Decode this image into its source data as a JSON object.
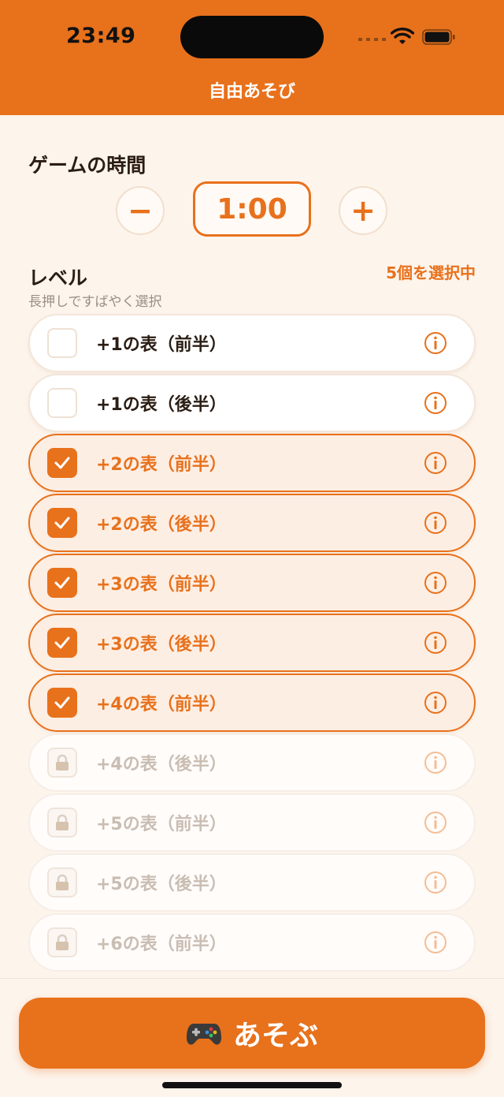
{
  "status": {
    "time": "23:49"
  },
  "nav": {
    "title": "自由あそび"
  },
  "game_time": {
    "title": "ゲームの時間",
    "minus": "−",
    "value": "1:00",
    "plus": "+"
  },
  "level": {
    "title": "レベル",
    "subtitle": "長押しですばやく選択",
    "selected_count": "5個を選択中",
    "items": [
      {
        "label": "+1の表（前半）",
        "state": "unchecked"
      },
      {
        "label": "+1の表（後半）",
        "state": "unchecked"
      },
      {
        "label": "+2の表（前半）",
        "state": "checked"
      },
      {
        "label": "+2の表（後半）",
        "state": "checked"
      },
      {
        "label": "+3の表（前半）",
        "state": "checked"
      },
      {
        "label": "+3の表（後半）",
        "state": "checked"
      },
      {
        "label": "+4の表（前半）",
        "state": "checked"
      },
      {
        "label": "+4の表（後半）",
        "state": "locked"
      },
      {
        "label": "+5の表（前半）",
        "state": "locked"
      },
      {
        "label": "+5の表（後半）",
        "state": "locked"
      },
      {
        "label": "+6の表（前半）",
        "state": "locked"
      }
    ]
  },
  "play": {
    "label": "あそぶ",
    "icon": "gamepad-icon"
  },
  "colors": {
    "accent": "#E8711C",
    "background": "#FDF4EC"
  }
}
